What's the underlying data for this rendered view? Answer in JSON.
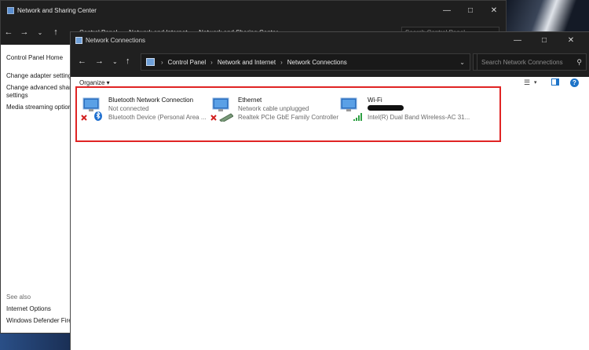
{
  "back_window": {
    "title": "Network and Sharing Center",
    "path": [
      "Control Panel",
      "Network and Internet",
      "Network and Sharing Center"
    ],
    "search_placeholder": "Search Control Panel",
    "left_links": [
      "Control Panel Home",
      "Change adapter setting",
      "Change advanced shari",
      "settings",
      "Media streaming option"
    ],
    "see_also": "See also",
    "see_also_links": [
      "Internet Options",
      "Windows Defender Fire"
    ]
  },
  "window": {
    "title": "Network Connections",
    "path": [
      "Control Panel",
      "Network and Internet",
      "Network Connections"
    ],
    "search_placeholder": "Search Network Connections",
    "organize_label": "Organize ▾"
  },
  "connections": [
    {
      "name": "Bluetooth Network Connection",
      "status": "Not connected",
      "device": "Bluetooth Device (Personal Area ...",
      "icon": "bluetooth-adapter-icon"
    },
    {
      "name": "Ethernet",
      "status": "Network cable unplugged",
      "device": "Realtek PCIe GbE Family Controller",
      "icon": "ethernet-adapter-icon"
    },
    {
      "name": "Wi-Fi",
      "status": "",
      "device": "Intel(R) Dual Band Wireless-AC 31...",
      "icon": "wifi-adapter-icon"
    }
  ],
  "colors": {
    "highlight": "#e02424",
    "titlebar": "#202020",
    "help_icon": "#1e74c8"
  }
}
